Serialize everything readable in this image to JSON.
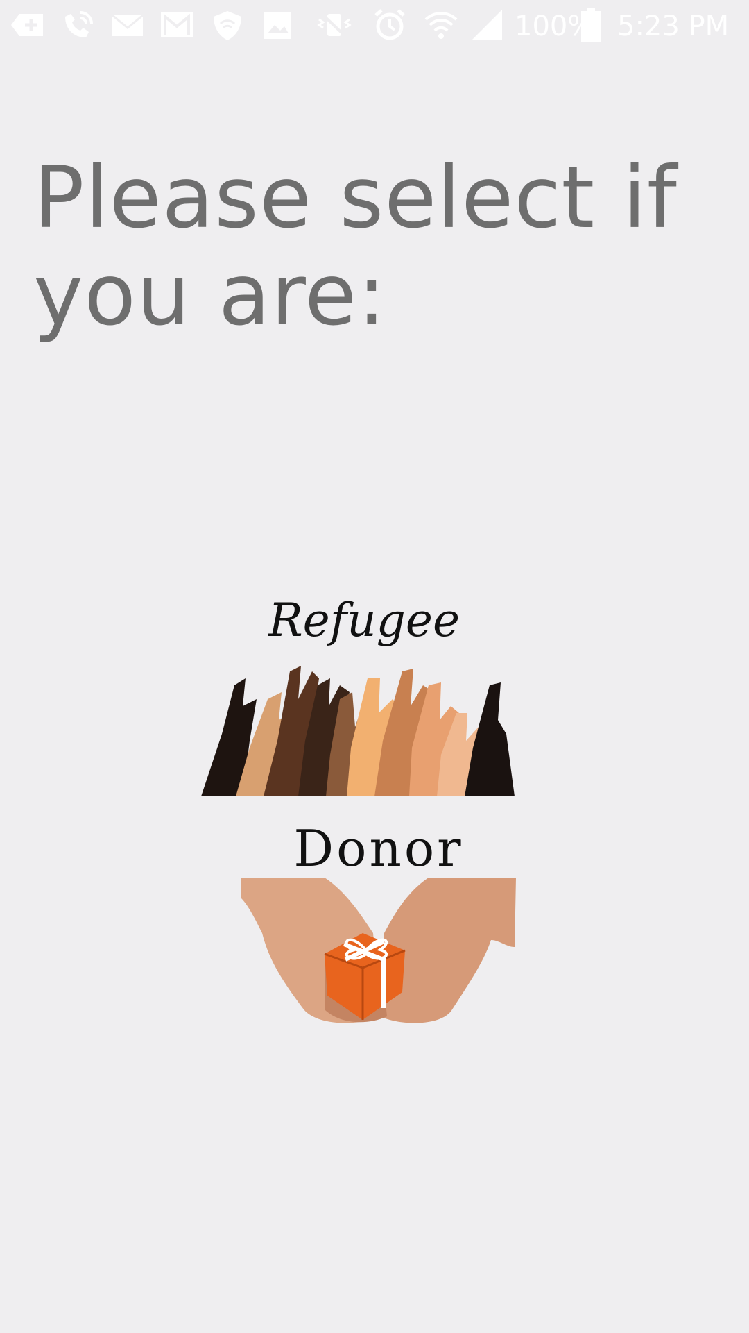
{
  "status_bar": {
    "battery": "100%",
    "time": "5:23 PM",
    "icons": [
      "add-icon",
      "wifi-calling-icon",
      "mail-icon",
      "gmail-icon",
      "shield-icon",
      "gallery-icon",
      "vibrate-icon",
      "alarm-icon",
      "wifi-icon",
      "signal-icon",
      "battery-icon"
    ]
  },
  "title": "Please select if you are:",
  "options": [
    {
      "label": "Refugee",
      "image": "raised-hands-image"
    },
    {
      "label": "Donor",
      "image": "hands-holding-gift-image"
    }
  ],
  "colors": {
    "background": "#efeef0",
    "title_text": "#6e6e6e",
    "gift": "#e8641e"
  }
}
